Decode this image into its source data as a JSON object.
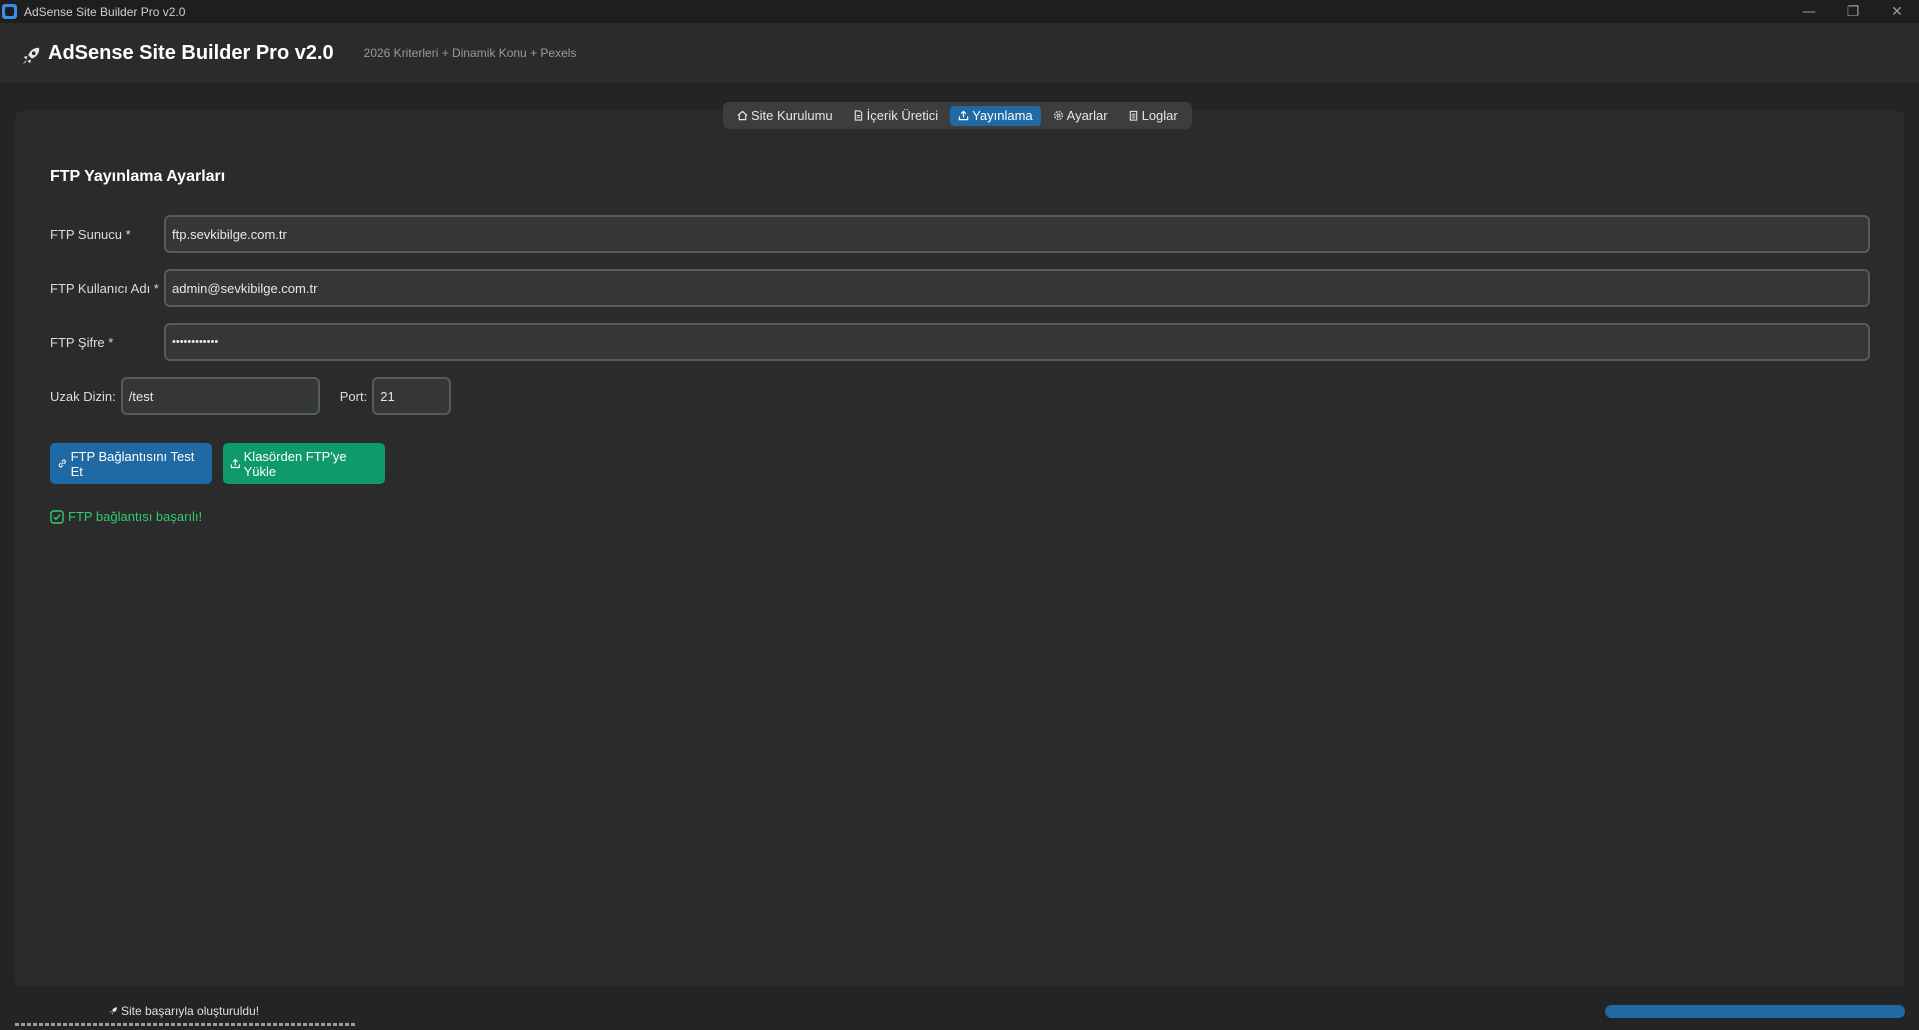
{
  "window": {
    "title": "AdSense Site Builder Pro v2.0",
    "controls": {
      "minimize": "—",
      "restore": "❐",
      "close": "✕"
    }
  },
  "header": {
    "icon": "rocket-icon",
    "title": "AdSense Site Builder Pro v2.0",
    "subtitle": "2026 Kriterleri + Dinamik Konu + Pexels"
  },
  "tabs": [
    {
      "label": "Site Kurulumu",
      "icon": "home-icon",
      "active": false
    },
    {
      "label": "İçerik Üretici",
      "icon": "document-icon",
      "active": false
    },
    {
      "label": "Yayınlama",
      "icon": "upload-icon",
      "active": true
    },
    {
      "label": "Ayarlar",
      "icon": "gear-icon",
      "active": false
    },
    {
      "label": "Loglar",
      "icon": "clipboard-icon",
      "active": false
    }
  ],
  "form": {
    "section_title": "FTP Yayınlama Ayarları",
    "ftp_server": {
      "label": "FTP Sunucu *",
      "value": "ftp.sevkibilge.com.tr"
    },
    "ftp_username": {
      "label": "FTP Kullanıcı Adı *",
      "value": "admin@sevkibilge.com.tr"
    },
    "ftp_password": {
      "label": "FTP Şifre *",
      "value": "••••••••••••"
    },
    "remote_dir": {
      "label": "Uzak Dizin:",
      "value": "/test"
    },
    "port": {
      "label": "Port:",
      "value": "21"
    }
  },
  "buttons": {
    "test_connection": {
      "label": "FTP Bağlantısını Test Et",
      "icon": "link-icon",
      "color": "#1f6aa5"
    },
    "upload_from_folder": {
      "label": "Klasörden FTP'ye Yükle",
      "icon": "upload-icon",
      "color": "#0e9a6a"
    }
  },
  "status": {
    "connection_message": "FTP bağlantısı başarılı!",
    "connection_icon": "check-box-icon",
    "success_color": "#2ecc71"
  },
  "footer": {
    "status_message": "Site başarıyla oluşturuldu!",
    "status_icon": "rocket-icon",
    "progress": 1.0
  },
  "colors": {
    "accent": "#1f6aa5",
    "success_button": "#0e9a6a",
    "background": "#242424",
    "panel": "#2b2b2b"
  }
}
